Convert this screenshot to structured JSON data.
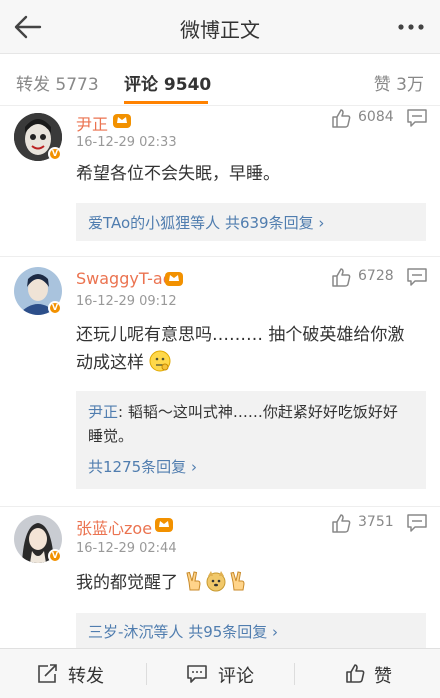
{
  "header": {
    "title": "微博正文"
  },
  "tabs": {
    "repost": "转发 5773",
    "comments": "评论 9540",
    "likes": "赞 3万"
  },
  "comments": [
    {
      "user": "尹正",
      "time": "16-12-29 02:33",
      "likes": "6084",
      "text": "希望各位不会失眠，早睡。",
      "replies_prefix": "爱TAo的小狐狸等人",
      "replies_count": "共639条回复 ›"
    },
    {
      "user": "SwaggyT-ao",
      "time": "16-12-29 09:12",
      "likes": "6728",
      "text_line1": "还玩儿呢有意思吗……… 抽个破英雄给你激",
      "text_line2": "动成这样",
      "reply_user": "尹正",
      "reply_text_line1": ": 韬韬～这叫式神……你赶紧好好吃饭好好",
      "reply_text_line2": "睡觉。",
      "replies_count": "共1275条回复 ›"
    },
    {
      "user": "张蓝心zoe",
      "time": "16-12-29 02:44",
      "likes": "3751",
      "text": "我的都觉醒了",
      "replies_prefix": "三岁-沐沉等人",
      "replies_count": "共95条回复 ›"
    }
  ],
  "bottom": {
    "repost": "转发",
    "comment": "评论",
    "like": "赞"
  },
  "colors": {
    "accent": "#ff8200",
    "username": "#eb7350",
    "link": "#507daf",
    "vip": "#f29100"
  }
}
